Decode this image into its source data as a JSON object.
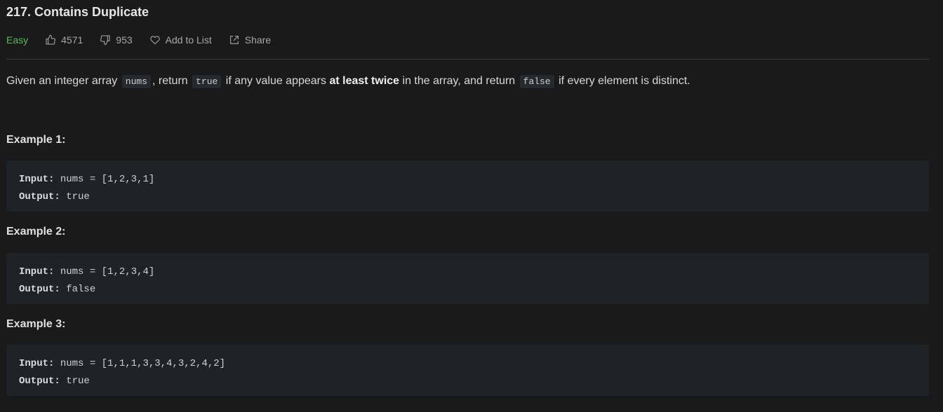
{
  "problem": {
    "title": "217. Contains Duplicate",
    "difficulty": "Easy",
    "likes": "4571",
    "dislikes": "953",
    "add_to_list": "Add to List",
    "share": "Share"
  },
  "description": {
    "part1": "Given an integer array",
    "code1": "nums",
    "part2": ", return",
    "code2": "true",
    "part3": "if any value appears",
    "bold": "at least twice",
    "part4": "in the array, and return",
    "code3": "false",
    "part5": "if every element is distinct."
  },
  "examples": [
    {
      "title": "Example 1:",
      "input_label": "Input:",
      "input": "nums = [1,2,3,1]",
      "output_label": "Output:",
      "output": "true"
    },
    {
      "title": "Example 2:",
      "input_label": "Input:",
      "input": "nums = [1,2,3,4]",
      "output_label": "Output:",
      "output": "false"
    },
    {
      "title": "Example 3:",
      "input_label": "Input:",
      "input": "nums = [1,1,1,3,3,4,3,2,4,2]",
      "output_label": "Output:",
      "output": "true"
    }
  ],
  "colors": {
    "background": "#1a1a1b",
    "easy": "#5cb85c",
    "code_block": "#1f2326"
  }
}
